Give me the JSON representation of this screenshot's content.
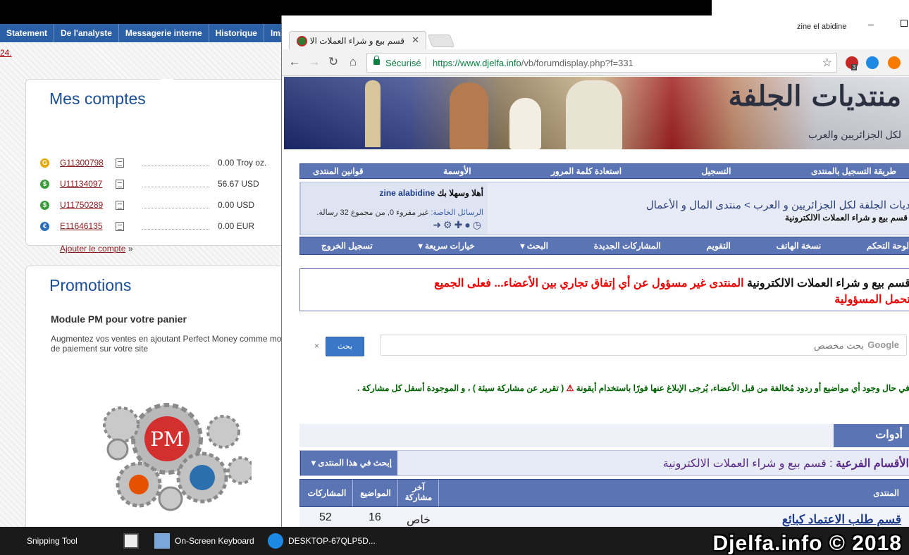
{
  "background_site": {
    "nav": [
      "Statement",
      "De l'analyste",
      "Messagerie interne",
      "Historique",
      "Impos"
    ],
    "date_fragment": "24.",
    "accounts_title": "Mes comptes",
    "accounts": [
      {
        "id": "G11300798",
        "amount": "0.00 Troy oz.",
        "coin_color": "#e0a800",
        "coin_symbol": "G"
      },
      {
        "id": "U11134097",
        "amount": "56.67 USD",
        "coin_color": "#3b9b3b",
        "coin_symbol": "$"
      },
      {
        "id": "U11750289",
        "amount": "0.00 USD",
        "coin_color": "#3b9b3b",
        "coin_symbol": "$"
      },
      {
        "id": "E11646135",
        "amount": "0.00 EUR",
        "coin_color": "#2a6fb8",
        "coin_symbol": "€"
      }
    ],
    "add_account": "Ajouter le compte",
    "add_account_arrow": "»",
    "promotions_title": "Promotions",
    "promo_heading": "Module PM pour votre panier",
    "promo_text": "Augmentez vos ventes en ajoutant Perfect Money comme mo de paiement sur votre site",
    "promo_logo_text": "PM"
  },
  "browser": {
    "tab_title": "قسم بيع و شراء العملات الا",
    "window_user": "zine el abidine",
    "security_label": "Sécurisé",
    "url_host": "https://www.djelfa.info",
    "url_path": "/vb/forumdisplay.php?f=331",
    "extension_badge": "3"
  },
  "forum": {
    "banner_logo": "منتديات الجلفة",
    "banner_sub": "لكل الجزائريين والعرب",
    "top_menu": [
      "طريقة التسجيل بالمنتدى",
      "التسجيل",
      "استعادة كلمة المرور",
      "الأوسمة",
      "قوانين المنتدى"
    ],
    "greeting_prefix": "أهلا وسهلا بك",
    "username": "zine alabidine",
    "pm_label": "الرسائل الخاصة:",
    "pm_text": "غير مقروء 0, من مجموع 32 رسالة.",
    "breadcrumb": "منتديات الجلفة لكل الجزائريين و العرب > منتدى المال و الأعمال",
    "current_forum": "قسم بيع و شراء العملات الالكترونية",
    "sub_menu": [
      "لوحة التحكم",
      "نسخة الهاتف",
      "التقويم",
      "المشاركات الجديدة",
      "البحث ▾",
      "خيارات سريعة ▾",
      "تسجيل الخروج"
    ],
    "notice_prefix": "قسم بيع و شراء العملات الالكترونية",
    "notice_red": "المنتدى غير مسؤول عن أي إتفاق تجاري بين الأعضاء... فعلى الجميع",
    "notice_line2": "تحمل المسؤولية",
    "search_button": "بحث",
    "search_close": "×",
    "search_placeholder": "بحث مخصص",
    "search_brand": "Google",
    "report_text": "في حال وجود أي مواضيع أو ردود مُخالفة من قبل الأعضاء، يُرجى الإبلاغ عنها فورًا باستخدام أيقونة",
    "report_icon_label": "( تقرير عن مشاركة سيئة )",
    "report_tail": "، و الموجودة أسفل كل مشاركة .",
    "topics_tab": "أدوات المواضيع",
    "subforums_label": "الأقسام الفرعية",
    "subforums_name": "قسم بيع و شراء العملات الالكترونية",
    "search_in_forum": "إبحث في هذا المنتدى ▾",
    "columns": {
      "forum": "المنتدى",
      "last_post": "آخر مشاركة",
      "topics": "المواضيع",
      "posts": "المشاركات"
    },
    "rows": [
      {
        "title": "قسم طلب الاعتماد كبائع",
        "last_post": "خاص",
        "topics": "16",
        "posts": "52"
      }
    ]
  },
  "taskbar": {
    "items": [
      "Snipping Tool",
      "On-Screen Keyboard",
      "DESKTOP-67QLP5D..."
    ]
  },
  "watermark": "Djelfa.info © 2018"
}
